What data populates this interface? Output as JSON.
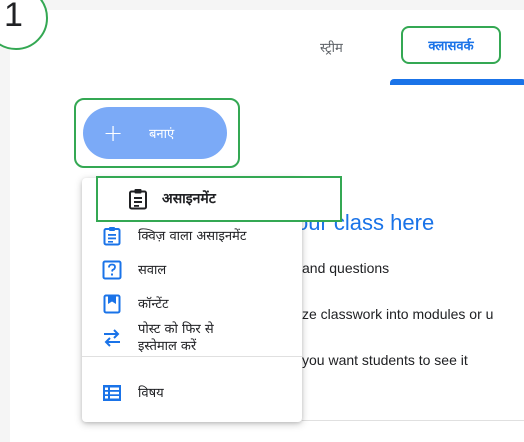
{
  "step_badge": "1",
  "tabs": {
    "stream": "स्ट्रीम",
    "classwork": "क्लासवर्क"
  },
  "create_button": {
    "icon": "plus-icon",
    "label": "बनाएं"
  },
  "menu": {
    "highlighted": {
      "icon": "assignment-icon",
      "label": "असाइनमेंट"
    },
    "items": [
      {
        "icon": "quiz-assignment-icon",
        "label": "क्विज़ वाला असाइनमेंट"
      },
      {
        "icon": "question-icon",
        "label": "सवाल"
      },
      {
        "icon": "material-icon",
        "label": "कॉन्टेंट"
      },
      {
        "icon": "reuse-post-icon",
        "label_line1": "पोस्ट को फिर से",
        "label_line2": "इस्तेमाल करें"
      },
      {
        "icon": "topic-icon",
        "label": "विषय"
      }
    ]
  },
  "background": {
    "heading": "our class here",
    "line1": "and questions",
    "line2": "ze classwork into modules or u",
    "line3": "you want students to see it"
  },
  "colors": {
    "accent_blue": "#1a73e8",
    "create_button": "#7baaf7",
    "highlight_green": "#34a853"
  }
}
